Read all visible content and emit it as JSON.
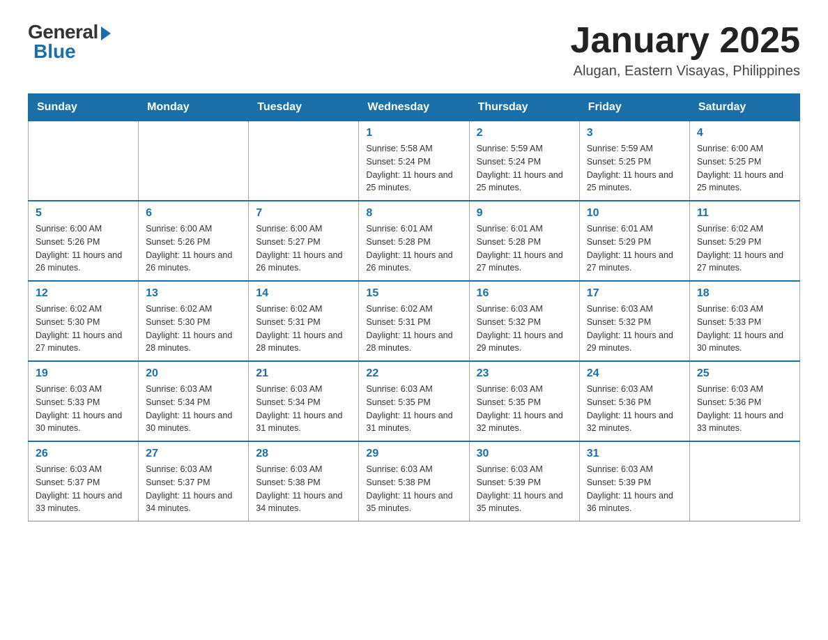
{
  "logo": {
    "general": "General",
    "blue": "Blue"
  },
  "title": "January 2025",
  "subtitle": "Alugan, Eastern Visayas, Philippines",
  "days": [
    "Sunday",
    "Monday",
    "Tuesday",
    "Wednesday",
    "Thursday",
    "Friday",
    "Saturday"
  ],
  "weeks": [
    [
      {
        "num": "",
        "info": ""
      },
      {
        "num": "",
        "info": ""
      },
      {
        "num": "",
        "info": ""
      },
      {
        "num": "1",
        "info": "Sunrise: 5:58 AM\nSunset: 5:24 PM\nDaylight: 11 hours and 25 minutes."
      },
      {
        "num": "2",
        "info": "Sunrise: 5:59 AM\nSunset: 5:24 PM\nDaylight: 11 hours and 25 minutes."
      },
      {
        "num": "3",
        "info": "Sunrise: 5:59 AM\nSunset: 5:25 PM\nDaylight: 11 hours and 25 minutes."
      },
      {
        "num": "4",
        "info": "Sunrise: 6:00 AM\nSunset: 5:25 PM\nDaylight: 11 hours and 25 minutes."
      }
    ],
    [
      {
        "num": "5",
        "info": "Sunrise: 6:00 AM\nSunset: 5:26 PM\nDaylight: 11 hours and 26 minutes."
      },
      {
        "num": "6",
        "info": "Sunrise: 6:00 AM\nSunset: 5:26 PM\nDaylight: 11 hours and 26 minutes."
      },
      {
        "num": "7",
        "info": "Sunrise: 6:00 AM\nSunset: 5:27 PM\nDaylight: 11 hours and 26 minutes."
      },
      {
        "num": "8",
        "info": "Sunrise: 6:01 AM\nSunset: 5:28 PM\nDaylight: 11 hours and 26 minutes."
      },
      {
        "num": "9",
        "info": "Sunrise: 6:01 AM\nSunset: 5:28 PM\nDaylight: 11 hours and 27 minutes."
      },
      {
        "num": "10",
        "info": "Sunrise: 6:01 AM\nSunset: 5:29 PM\nDaylight: 11 hours and 27 minutes."
      },
      {
        "num": "11",
        "info": "Sunrise: 6:02 AM\nSunset: 5:29 PM\nDaylight: 11 hours and 27 minutes."
      }
    ],
    [
      {
        "num": "12",
        "info": "Sunrise: 6:02 AM\nSunset: 5:30 PM\nDaylight: 11 hours and 27 minutes."
      },
      {
        "num": "13",
        "info": "Sunrise: 6:02 AM\nSunset: 5:30 PM\nDaylight: 11 hours and 28 minutes."
      },
      {
        "num": "14",
        "info": "Sunrise: 6:02 AM\nSunset: 5:31 PM\nDaylight: 11 hours and 28 minutes."
      },
      {
        "num": "15",
        "info": "Sunrise: 6:02 AM\nSunset: 5:31 PM\nDaylight: 11 hours and 28 minutes."
      },
      {
        "num": "16",
        "info": "Sunrise: 6:03 AM\nSunset: 5:32 PM\nDaylight: 11 hours and 29 minutes."
      },
      {
        "num": "17",
        "info": "Sunrise: 6:03 AM\nSunset: 5:32 PM\nDaylight: 11 hours and 29 minutes."
      },
      {
        "num": "18",
        "info": "Sunrise: 6:03 AM\nSunset: 5:33 PM\nDaylight: 11 hours and 30 minutes."
      }
    ],
    [
      {
        "num": "19",
        "info": "Sunrise: 6:03 AM\nSunset: 5:33 PM\nDaylight: 11 hours and 30 minutes."
      },
      {
        "num": "20",
        "info": "Sunrise: 6:03 AM\nSunset: 5:34 PM\nDaylight: 11 hours and 30 minutes."
      },
      {
        "num": "21",
        "info": "Sunrise: 6:03 AM\nSunset: 5:34 PM\nDaylight: 11 hours and 31 minutes."
      },
      {
        "num": "22",
        "info": "Sunrise: 6:03 AM\nSunset: 5:35 PM\nDaylight: 11 hours and 31 minutes."
      },
      {
        "num": "23",
        "info": "Sunrise: 6:03 AM\nSunset: 5:35 PM\nDaylight: 11 hours and 32 minutes."
      },
      {
        "num": "24",
        "info": "Sunrise: 6:03 AM\nSunset: 5:36 PM\nDaylight: 11 hours and 32 minutes."
      },
      {
        "num": "25",
        "info": "Sunrise: 6:03 AM\nSunset: 5:36 PM\nDaylight: 11 hours and 33 minutes."
      }
    ],
    [
      {
        "num": "26",
        "info": "Sunrise: 6:03 AM\nSunset: 5:37 PM\nDaylight: 11 hours and 33 minutes."
      },
      {
        "num": "27",
        "info": "Sunrise: 6:03 AM\nSunset: 5:37 PM\nDaylight: 11 hours and 34 minutes."
      },
      {
        "num": "28",
        "info": "Sunrise: 6:03 AM\nSunset: 5:38 PM\nDaylight: 11 hours and 34 minutes."
      },
      {
        "num": "29",
        "info": "Sunrise: 6:03 AM\nSunset: 5:38 PM\nDaylight: 11 hours and 35 minutes."
      },
      {
        "num": "30",
        "info": "Sunrise: 6:03 AM\nSunset: 5:39 PM\nDaylight: 11 hours and 35 minutes."
      },
      {
        "num": "31",
        "info": "Sunrise: 6:03 AM\nSunset: 5:39 PM\nDaylight: 11 hours and 36 minutes."
      },
      {
        "num": "",
        "info": ""
      }
    ]
  ]
}
